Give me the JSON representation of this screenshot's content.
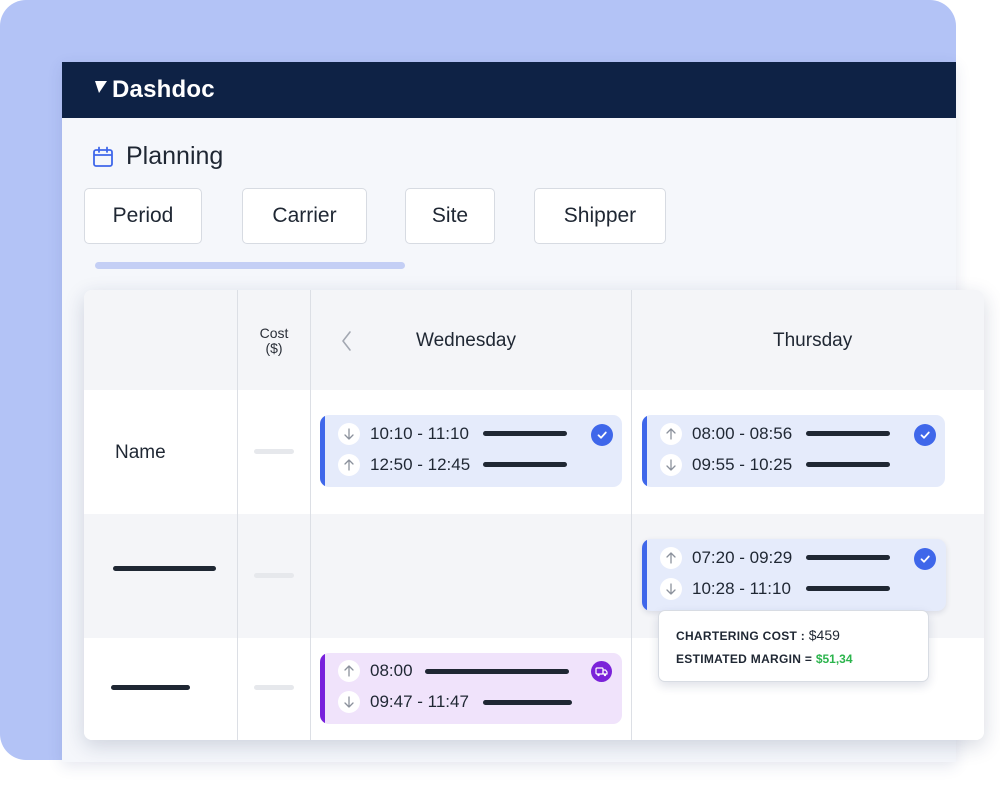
{
  "app": {
    "name": "Dashdoc"
  },
  "page": {
    "title": "Planning"
  },
  "filters": [
    "Period",
    "Carrier",
    "Site",
    "Shipper"
  ],
  "grid": {
    "cost_header_line1": "Cost",
    "cost_header_line2": "($)",
    "days": [
      "Wednesday",
      "Thursday"
    ],
    "row1_name": "Name"
  },
  "events": {
    "wed_row1": {
      "line1": "10:10 - 11:10",
      "line2": "12:50 - 12:45"
    },
    "thu_row1": {
      "line1": "08:00 - 08:56",
      "line2": "09:55 - 10:25"
    },
    "thu_row2": {
      "line1": "07:20 - 09:29",
      "line2": "10:28 - 11:10"
    },
    "wed_row3": {
      "line1": "08:00",
      "line2": "09:47 - 11:47"
    }
  },
  "tooltip": {
    "chartering_label": "CHARTERING COST :",
    "chartering_value": "$459",
    "margin_label": "ESTIMATED MARGIN =",
    "margin_value": "$51,34"
  },
  "colors": {
    "brand_navy": "#0e2245",
    "accent_blue": "#3f67ea",
    "accent_purple": "#7820dc",
    "margin_green": "#2bb44c",
    "background_lavender": "#b3c3f6"
  },
  "icons": [
    "calendar-icon",
    "chevron-left-icon",
    "arrow-down-icon",
    "arrow-up-icon",
    "check-circle-icon",
    "truck-icon"
  ]
}
